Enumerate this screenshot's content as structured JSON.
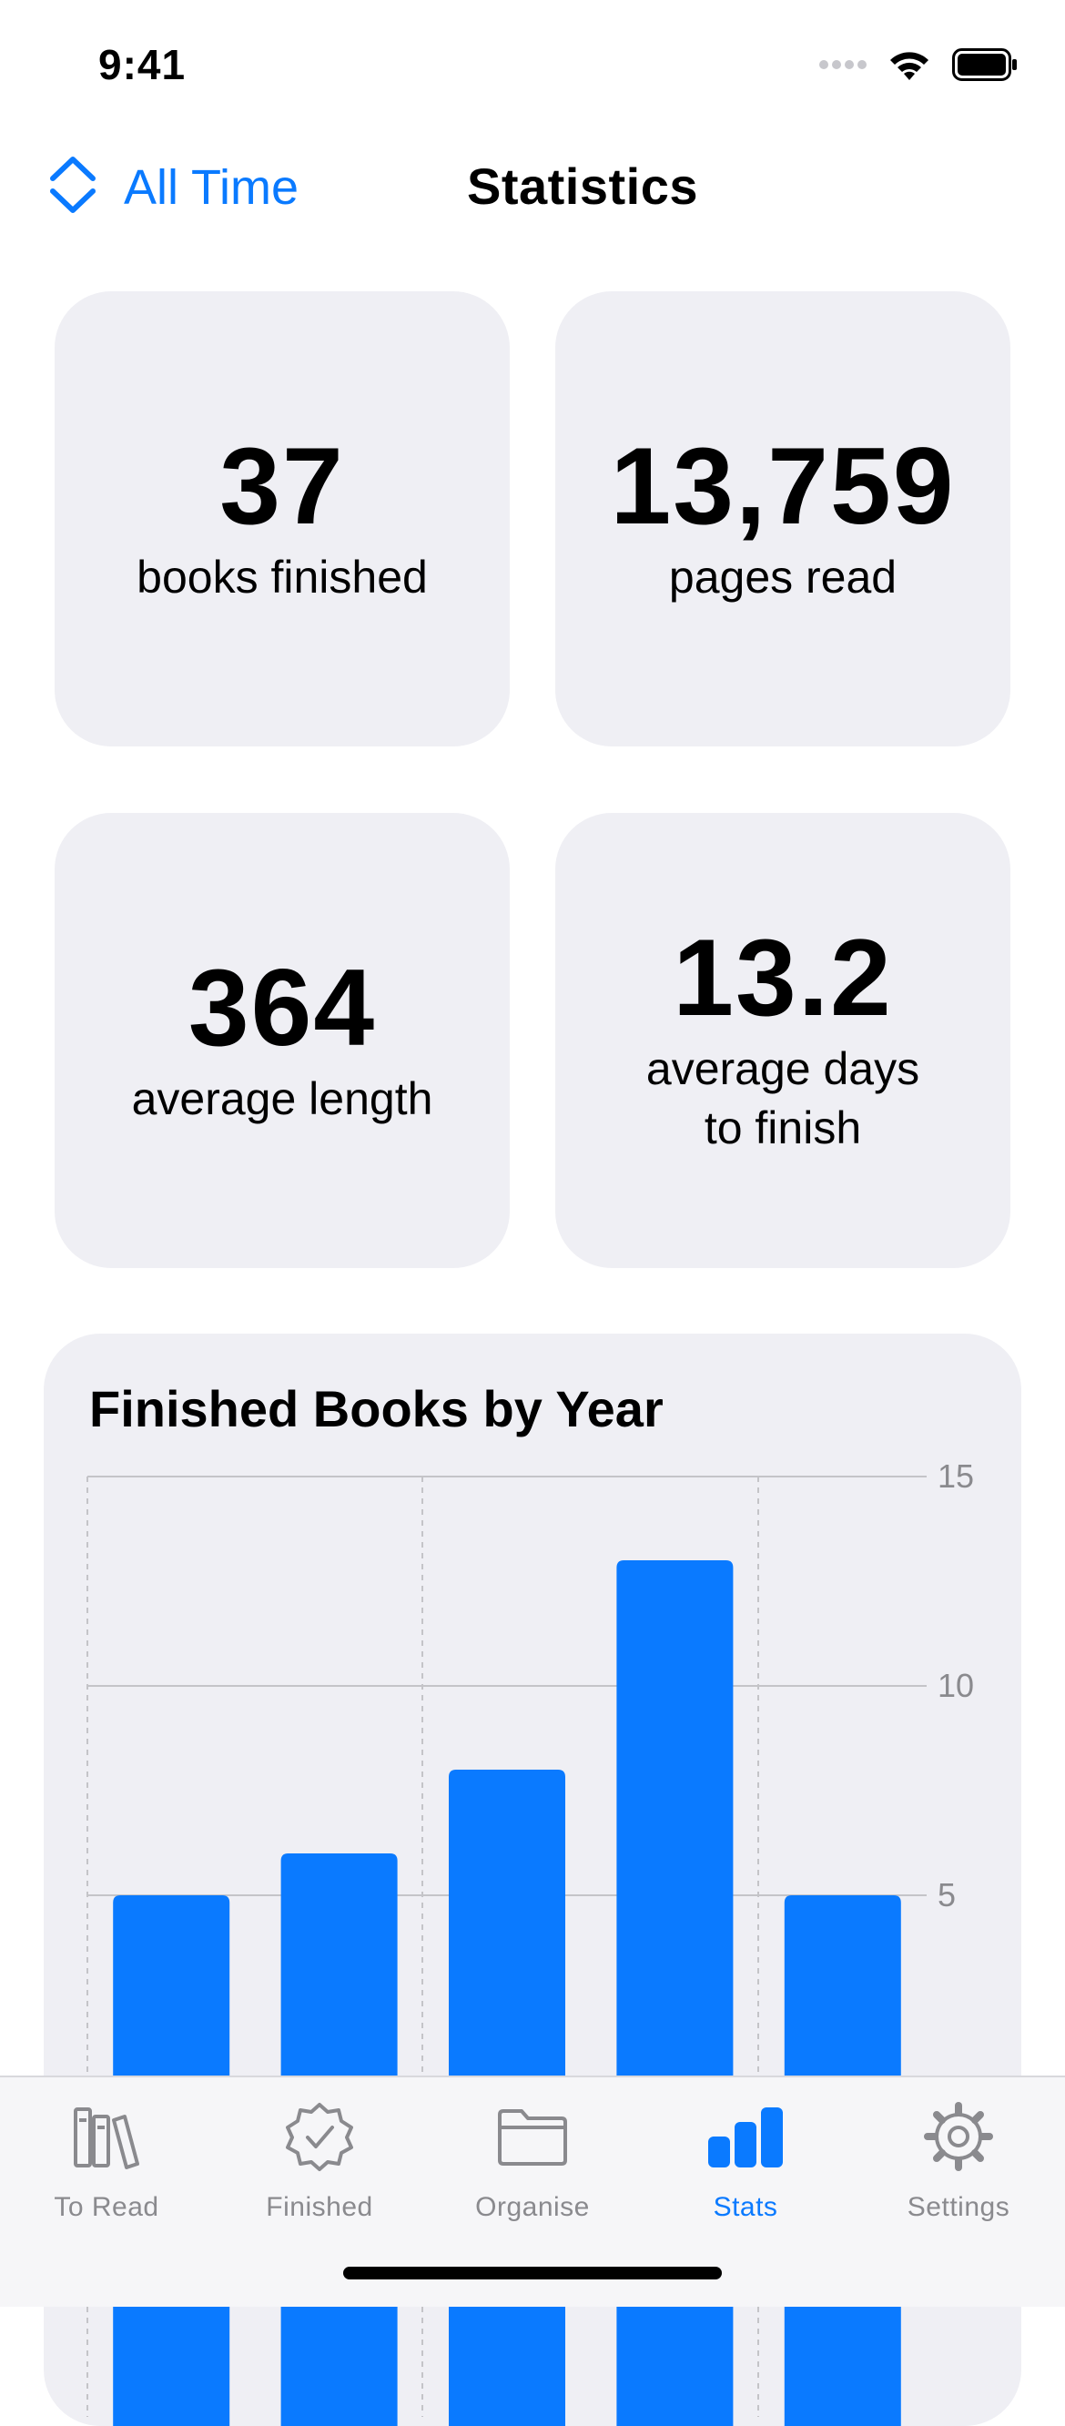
{
  "status": {
    "time": "9:41"
  },
  "nav": {
    "range_label": "All Time",
    "title": "Statistics"
  },
  "stats": [
    {
      "value": "37",
      "label": "books finished"
    },
    {
      "value": "13,759",
      "label": "pages read"
    },
    {
      "value": "364",
      "label": "average length"
    },
    {
      "value": "13.2",
      "label": "average days to finish"
    }
  ],
  "chart_data": {
    "type": "bar",
    "title": "Finished Books by Year",
    "categories": [
      "",
      "",
      "",
      "",
      ""
    ],
    "values": [
      5,
      6,
      8,
      13,
      5
    ],
    "ylim": [
      0,
      15
    ],
    "yticks": [
      5,
      10,
      15
    ],
    "y_axis_side": "right",
    "grid": true,
    "bar_color": "#0a7aff"
  },
  "tabs": [
    {
      "label": "To Read",
      "icon": "books-icon",
      "active": false
    },
    {
      "label": "Finished",
      "icon": "checkmark-seal-icon",
      "active": false
    },
    {
      "label": "Organise",
      "icon": "folder-icon",
      "active": false
    },
    {
      "label": "Stats",
      "icon": "chart-bar-icon",
      "active": true
    },
    {
      "label": "Settings",
      "icon": "gear-icon",
      "active": false
    }
  ],
  "colors": {
    "accent": "#0a7aff",
    "card_bg": "#efeff4",
    "inactive": "#8a8a8e"
  }
}
